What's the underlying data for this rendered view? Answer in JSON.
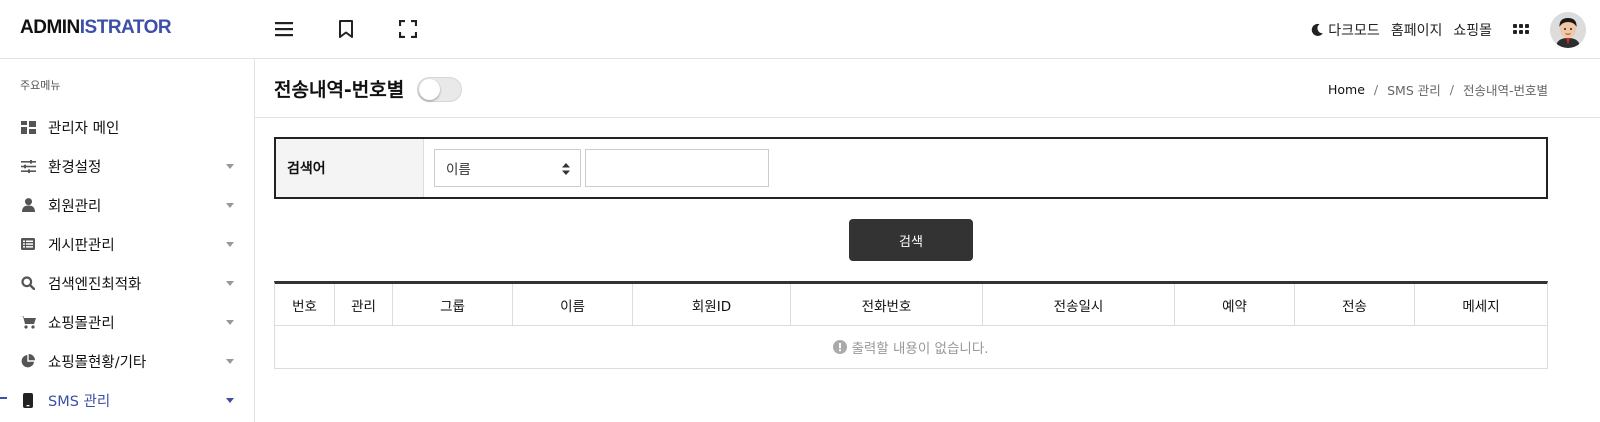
{
  "header": {
    "logo_part1": "ADMIN",
    "logo_part2": "ISTRATOR",
    "dark_mode_label": "다크모드",
    "homepage_label": "홈페이지",
    "shop_label": "쇼핑몰"
  },
  "sidebar": {
    "caption": "주요메뉴",
    "items": [
      {
        "label": "관리자 메인",
        "icon": "dashboard-icon",
        "has_caret": false
      },
      {
        "label": "환경설정",
        "icon": "sliders-icon",
        "has_caret": true
      },
      {
        "label": "회원관리",
        "icon": "user-icon",
        "has_caret": true
      },
      {
        "label": "게시판관리",
        "icon": "list-icon",
        "has_caret": true
      },
      {
        "label": "검색엔진최적화",
        "icon": "search-icon",
        "has_caret": true
      },
      {
        "label": "쇼핑몰관리",
        "icon": "cart-icon",
        "has_caret": true
      },
      {
        "label": "쇼핑몰현황/기타",
        "icon": "pie-chart-icon",
        "has_caret": true
      },
      {
        "label": "SMS 관리",
        "icon": "mobile-icon",
        "has_caret": true,
        "active": true
      }
    ]
  },
  "page": {
    "title": "전송내역-번호별",
    "toggle_on": false
  },
  "breadcrumb": {
    "home": "Home",
    "sep": "/",
    "section": "SMS 관리",
    "current": "전송내역-번호별"
  },
  "search": {
    "label": "검색어",
    "select_value": "이름",
    "input_value": "",
    "button_label": "검색"
  },
  "table": {
    "columns": [
      "번호",
      "관리",
      "그룹",
      "이름",
      "회원ID",
      "전화번호",
      "전송일시",
      "예약",
      "전송",
      "메세지"
    ],
    "empty_message": "출력할 내용이 없습니다."
  },
  "colors": {
    "accent": "#3d4fa8",
    "button_bg": "#333333"
  }
}
